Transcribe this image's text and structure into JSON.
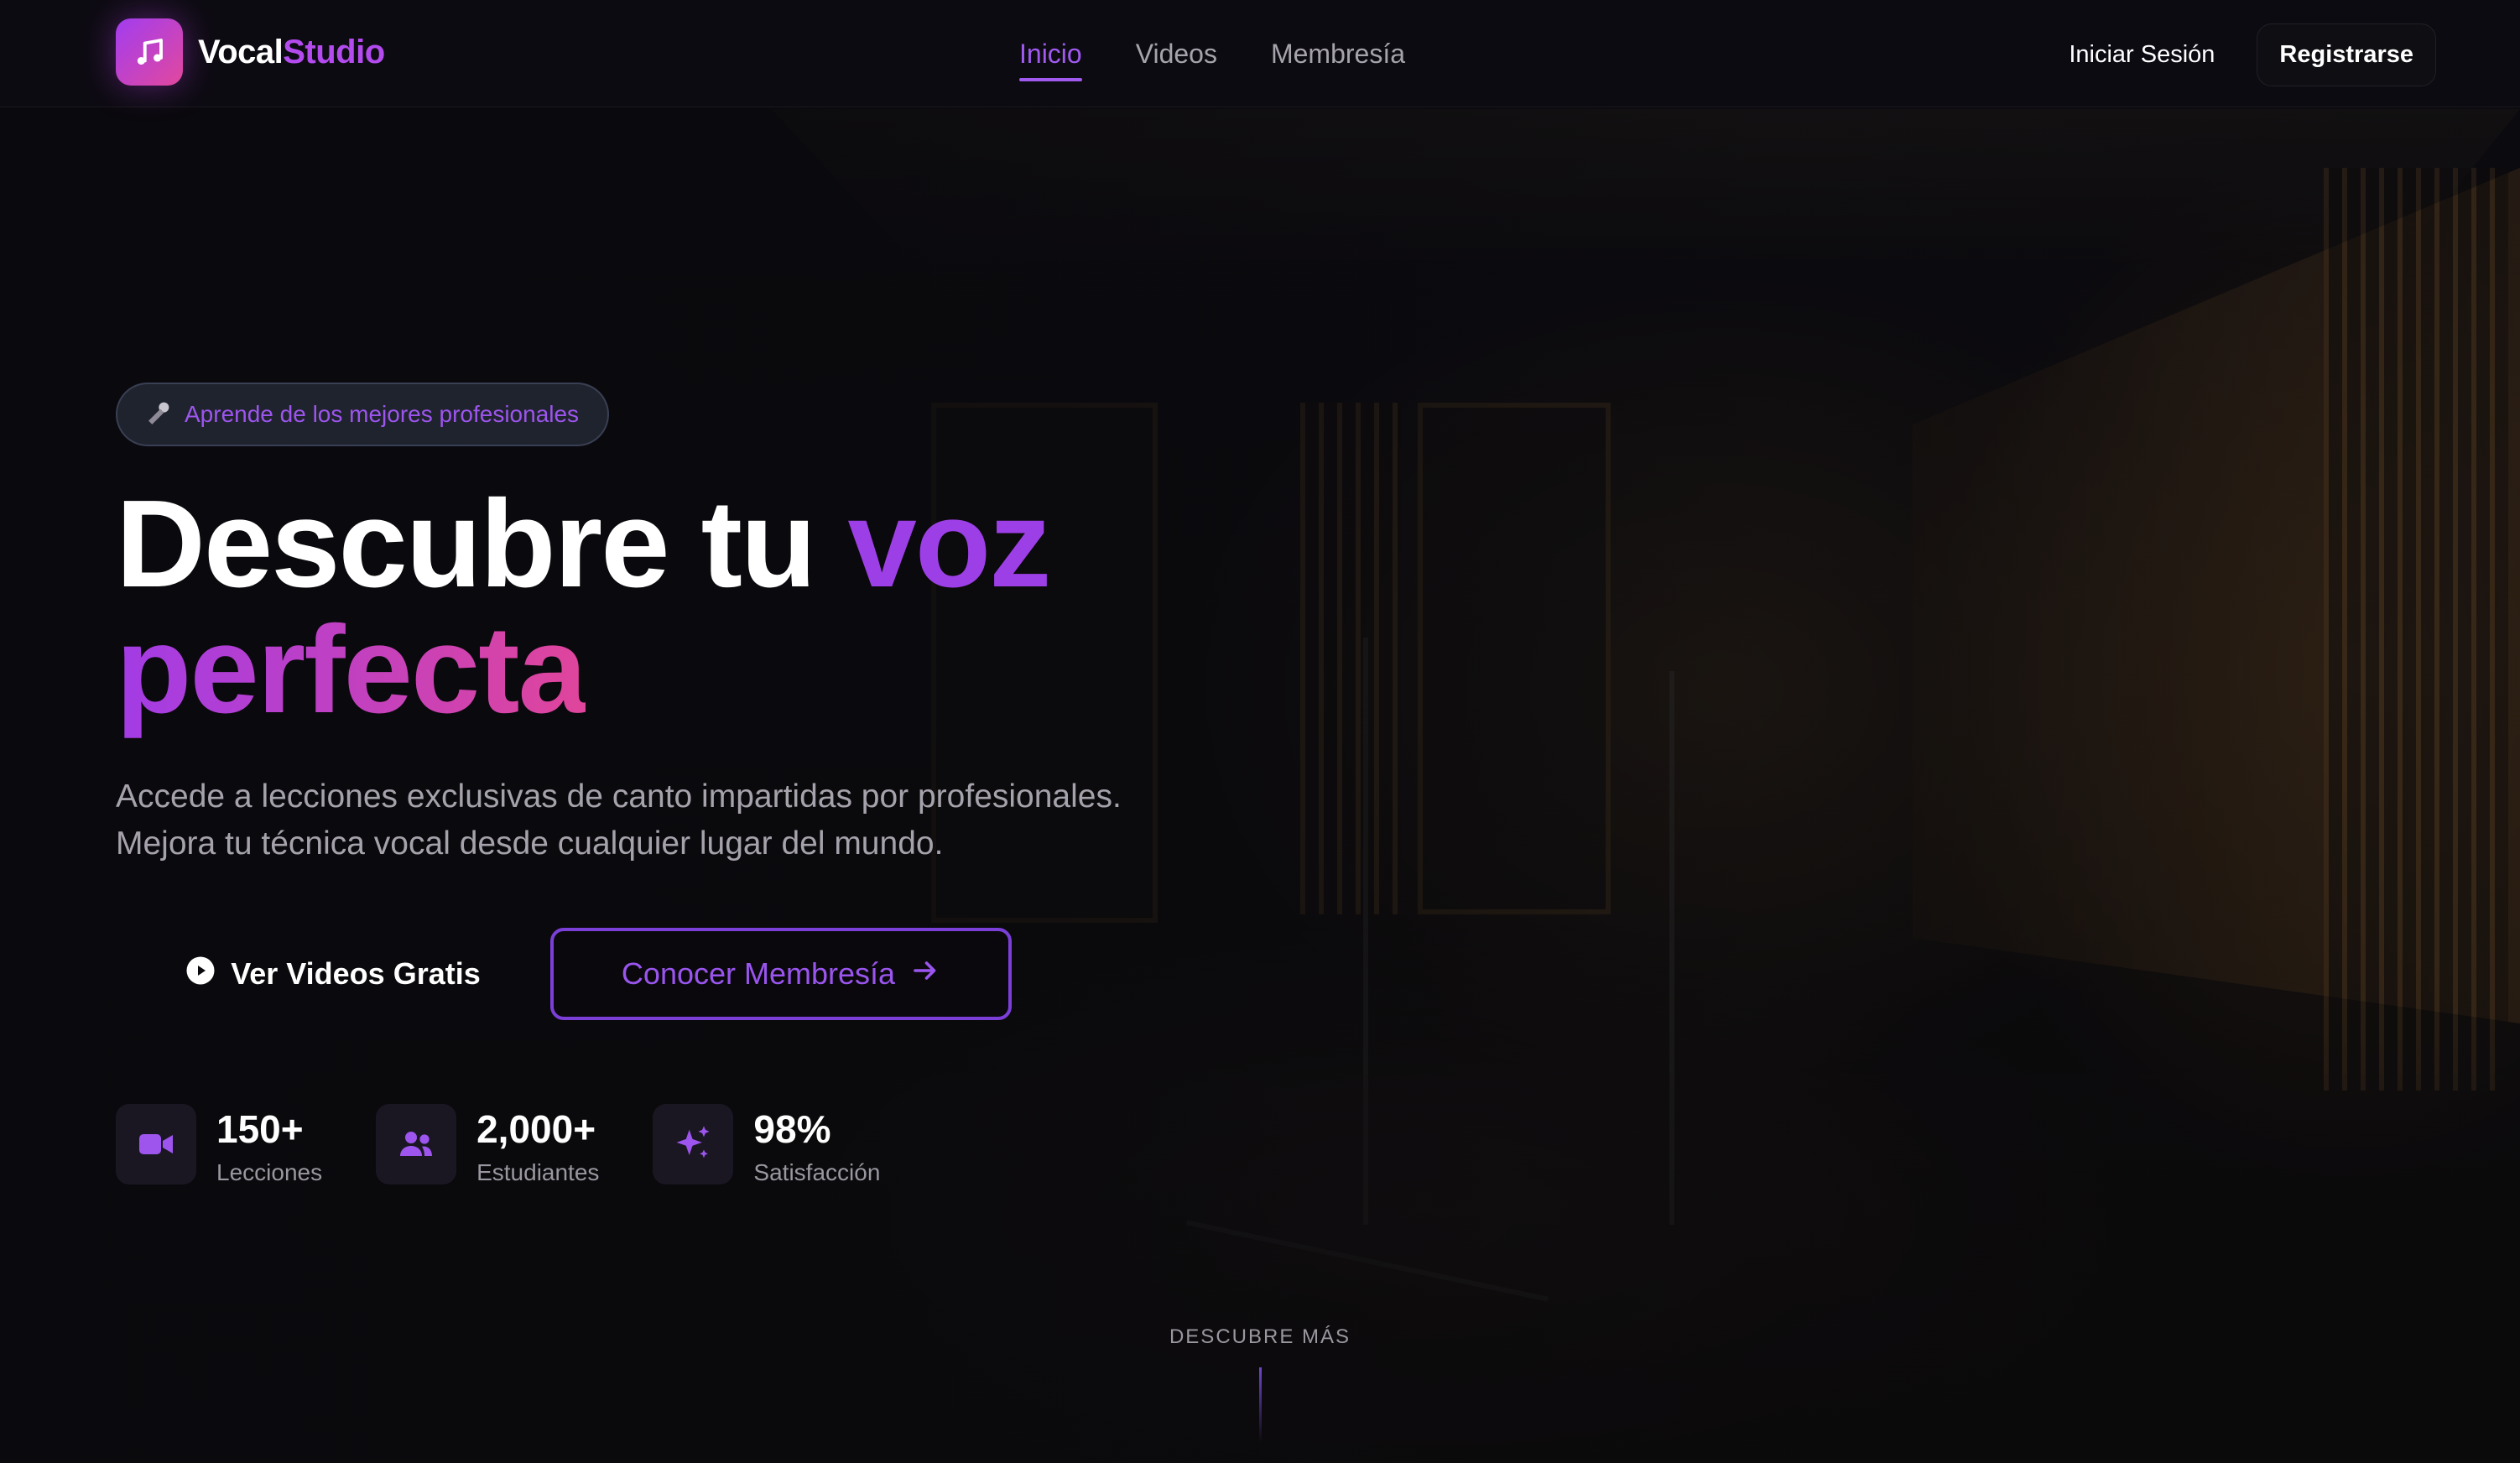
{
  "brand": {
    "name_part1": "Vocal",
    "name_part2": "Studio",
    "icon": "music-note-icon",
    "accent_color": "#b34bef",
    "gradient": [
      "#a23df0",
      "#e2489d"
    ]
  },
  "nav": {
    "items": [
      {
        "label": "Inicio",
        "active": true
      },
      {
        "label": "Videos",
        "active": false
      },
      {
        "label": "Membresía",
        "active": false
      }
    ]
  },
  "auth": {
    "login_label": "Iniciar Sesión",
    "register_label": "Registrarse"
  },
  "hero": {
    "badge_icon": "microphone-icon",
    "badge_text": "Aprende de los mejores profesionales",
    "title_part1": "Descubre tu ",
    "title_highlight1": "voz",
    "title_highlight2": "perfecta",
    "subtitle": "Accede a lecciones exclusivas de canto impartidas por profesionales. Mejora tu técnica vocal desde cualquier lugar del mundo.",
    "primary_cta": {
      "label": "Ver Videos Gratis",
      "icon": "play-circle-icon"
    },
    "secondary_cta": {
      "label": "Conocer Membresía",
      "icon": "arrow-right-icon"
    }
  },
  "stats": [
    {
      "icon": "video-camera-icon",
      "value": "150+",
      "label": "Lecciones"
    },
    {
      "icon": "users-icon",
      "value": "2,000+",
      "label": "Estudiantes"
    },
    {
      "icon": "sparkles-icon",
      "value": "98%",
      "label": "Satisfacción"
    }
  ],
  "scroll_hint": {
    "label": "DESCUBRE MÁS"
  },
  "colors": {
    "background": "#0a090d",
    "primary_purple": "#9d3fe6",
    "pink": "#e0459b",
    "muted_text": "#a6a2ab"
  }
}
